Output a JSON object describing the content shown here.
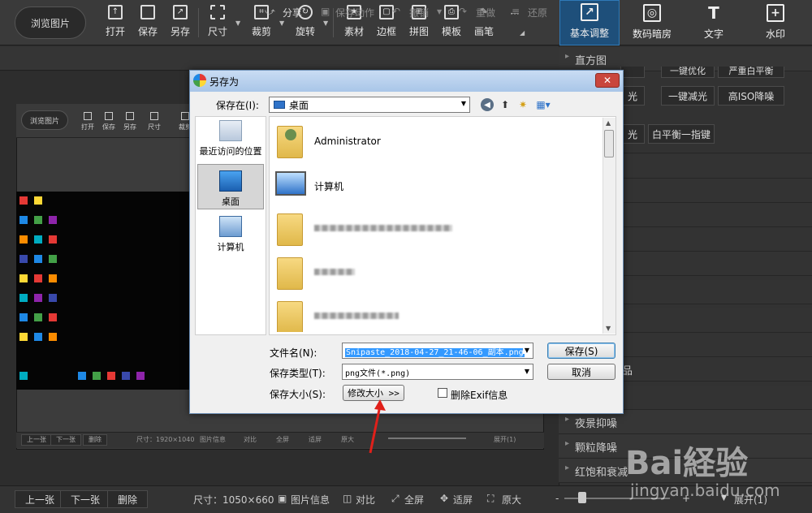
{
  "toolbar": {
    "browse_label": "浏览图片",
    "tools": [
      {
        "label": "打开",
        "icon": "open-icon"
      },
      {
        "label": "保存",
        "icon": "save-icon"
      },
      {
        "label": "另存",
        "icon": "save-as-icon"
      },
      {
        "label": "尺寸",
        "icon": "resize-icon"
      },
      {
        "label": "裁剪",
        "icon": "crop-icon"
      },
      {
        "label": "旋转",
        "icon": "rotate-icon"
      },
      {
        "label": "素材",
        "icon": "material-icon"
      },
      {
        "label": "边框",
        "icon": "border-icon"
      },
      {
        "label": "拼图",
        "icon": "collage-icon"
      },
      {
        "label": "模板",
        "icon": "template-icon"
      },
      {
        "label": "画笔",
        "icon": "brush-icon"
      }
    ],
    "more_label": "···",
    "right_tabs": [
      {
        "label": "基本调整",
        "icon": "adjust-icon"
      },
      {
        "label": "数码暗房",
        "icon": "camera-icon"
      },
      {
        "label": "文字",
        "icon": "text-icon"
      },
      {
        "label": "水印",
        "icon": "watermark-icon"
      }
    ]
  },
  "subbar": {
    "share": "分享",
    "save_action": "保存动作",
    "undo": "撤销",
    "redo": "重做",
    "restore": "还原"
  },
  "inner_screenshot": {
    "browse_label": "浏览图片",
    "tools": [
      "打开",
      "保存",
      "另存",
      "尺寸",
      "裁剪"
    ],
    "bottom_buttons": [
      "上一张",
      "下一张",
      "删除"
    ],
    "size_text": "尺寸：1920×1040",
    "stats": [
      "图片信息",
      "对比",
      "全屏",
      "适屏",
      "原大"
    ],
    "expand": "展开(1)"
  },
  "right_panel": {
    "histogram": "直方图",
    "buttons_row1": [
      "一键优化",
      "严重白平衡"
    ],
    "buttons_row2": [
      "光",
      "一键减光",
      "高ISO降噪"
    ],
    "buttons_row3": [
      "光",
      "白平衡一指键"
    ],
    "sections": [
      "夜景抑噪",
      "颗粒降噪",
      "红饱和衰减"
    ],
    "partial_label": "品"
  },
  "bottombar": {
    "prev": "上一张",
    "next": "下一张",
    "delete": "删除",
    "size": "尺寸：1050×660",
    "image_info": "图片信息",
    "compare": "对比",
    "fullscreen": "全屏",
    "fit": "适屏",
    "original": "原大",
    "zoom_minus": "-",
    "zoom_plus": "+",
    "expand": "展开(1)"
  },
  "dialog": {
    "title": "另存为",
    "close": "✕",
    "save_in_label": "保存在(I):",
    "location": "桌面",
    "places": [
      {
        "label": "最近访问的位置",
        "icon": "recent-places-icon"
      },
      {
        "label": "桌面",
        "icon": "desktop-icon"
      },
      {
        "label": "计算机",
        "icon": "computer-icon"
      }
    ],
    "files": [
      {
        "name": "Administrator",
        "icon": "user-folder-icon"
      },
      {
        "name": "计算机",
        "icon": "computer-icon"
      }
    ],
    "filename_label": "文件名(N):",
    "filename_value": "Snipaste_2018-04-27_21-46-06_副本.png",
    "filetype_label": "保存类型(T):",
    "filetype_value": "png文件(*.png)",
    "size_label": "保存大小(S):",
    "resize_button": "修改大小 >>",
    "exif_label": "删除Exif信息",
    "save_button": "保存(S)",
    "cancel_button": "取消"
  },
  "watermark": {
    "brand": "Bai経验",
    "url": "jingyan.baidu.com"
  },
  "colors": {
    "accent_tab": "#1e4f7a",
    "selection": "#3399ff",
    "annotation_arrow": "#e0201a"
  }
}
